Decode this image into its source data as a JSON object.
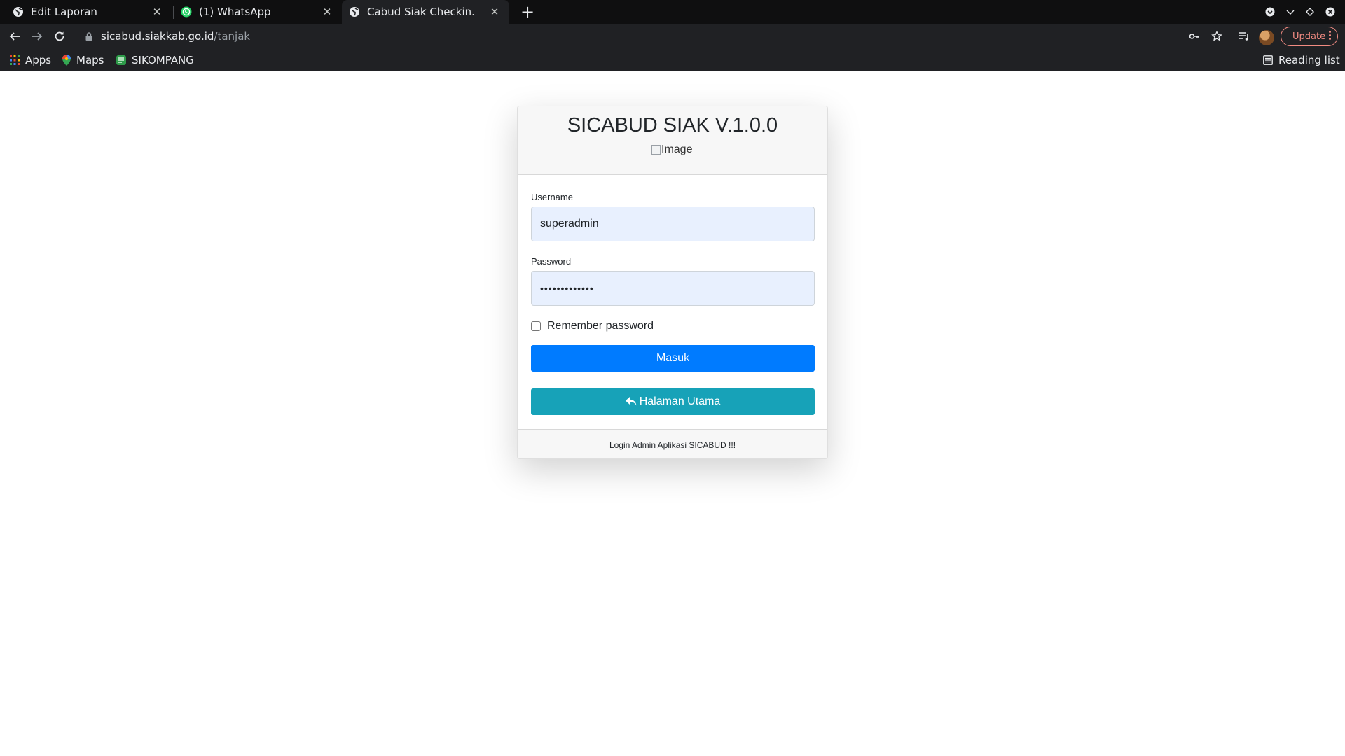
{
  "browser": {
    "tabs": [
      {
        "title": "Edit Laporan",
        "icon": "globe-icon"
      },
      {
        "title": "(1) WhatsApp",
        "icon": "whatsapp-icon"
      },
      {
        "title": "Cabud Siak Checkin.",
        "icon": "globe-icon"
      }
    ],
    "url_host": "sicabud.siakkab.go.id",
    "url_path": "/tanjak",
    "update_label": "Update",
    "bookmarks": [
      {
        "label": "Apps",
        "icon": "apps-grid-icon"
      },
      {
        "label": "Maps",
        "icon": "maps-pin-icon"
      },
      {
        "label": "SIKOMPANG",
        "icon": "bookmark-favicon-icon"
      }
    ],
    "reading_list": "Reading list"
  },
  "login": {
    "title": "SICABUD SIAK V.1.0.0",
    "image_alt": "Image",
    "username_label": "Username",
    "username_value": "superadmin",
    "password_label": "Password",
    "password_value": "•••••••••••••",
    "remember_label": "Remember password",
    "submit_label": "Masuk",
    "home_label": "Halaman Utama",
    "footer_text": "Login Admin Aplikasi SICABUD !!!"
  },
  "colors": {
    "primary": "#007bff",
    "info": "#17a2b8",
    "autofill": "#e8f0fe"
  }
}
